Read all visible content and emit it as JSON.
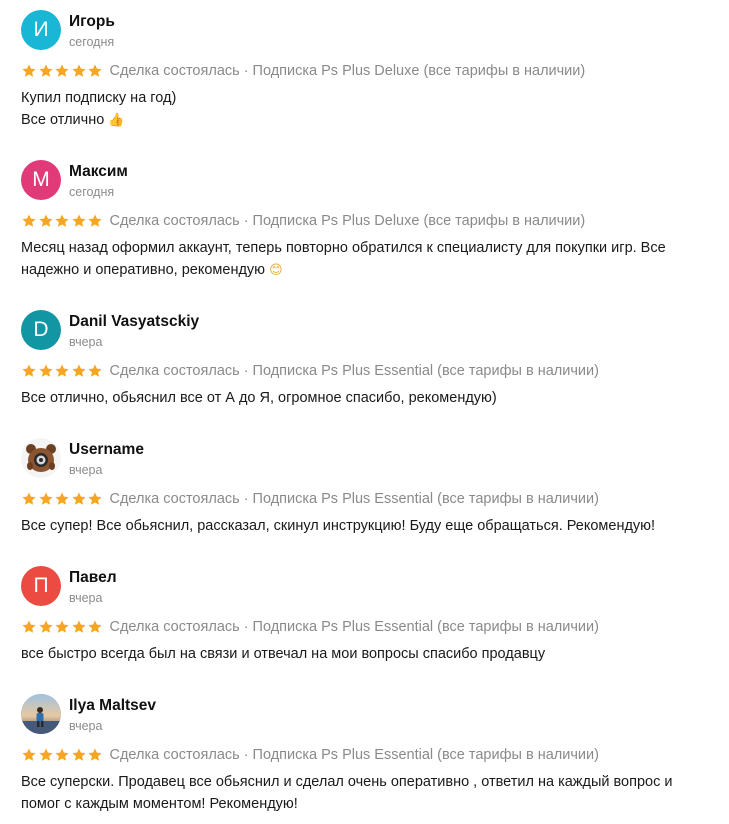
{
  "colors": {
    "star": "#f5a623",
    "avatar_igor": "#19b6d6",
    "avatar_maksim": "#e03a78",
    "avatar_danil": "#1296a4",
    "avatar_pavel": "#ec4b41"
  },
  "reviews": [
    {
      "avatar_letter": "И",
      "avatar_icon": "letter-avatar",
      "name": "Игорь",
      "date": "сегодня",
      "rating": 5,
      "deal": "Сделка состоялась",
      "separator": "·",
      "product": "Подписка Ps Plus Deluxe (все тарифы в наличии)",
      "lines": [
        "Купил подписку на год)",
        "Все отлично"
      ],
      "emoji": "👍"
    },
    {
      "avatar_letter": "М",
      "avatar_icon": "letter-avatar",
      "name": "Максим",
      "date": "сегодня",
      "rating": 5,
      "deal": "Сделка состоялась",
      "separator": "·",
      "product": "Подписка Ps Plus Deluxe (все тарифы в наличии)",
      "lines": [
        "Месяц назад оформил аккаунт, теперь повторно обратился к специалисту для покупки игр. Все",
        "надежно и оперативно, рекомендую"
      ],
      "emoji": "😊"
    },
    {
      "avatar_letter": "D",
      "avatar_icon": "letter-avatar",
      "name": "Danil Vasyatsckiy",
      "date": "вчера",
      "rating": 5,
      "deal": "Сделка состоялась",
      "separator": "·",
      "product": "Подписка Ps Plus Essential (все тарифы в наличии)",
      "lines": [
        "Все отлично, обьяснил все от А до Я, огромное спасибо, рекомендую)"
      ]
    },
    {
      "avatar_icon": "bear-photo-avatar",
      "name": "Username",
      "date": "вчера",
      "rating": 5,
      "deal": "Сделка состоялась",
      "separator": "·",
      "product": "Подписка Ps Plus Essential (все тарифы в наличии)",
      "lines": [
        "Все супер! Все обьяснил, рассказал, скинул инструкцию! Буду еще обращаться. Рекомендую!"
      ]
    },
    {
      "avatar_letter": "П",
      "avatar_icon": "letter-avatar",
      "name": "Павел",
      "date": "вчера",
      "rating": 5,
      "deal": "Сделка состоялась",
      "separator": "·",
      "product": "Подписка Ps Plus Essential (все тарифы в наличии)",
      "lines": [
        "все быстро всегда был на связи и отвечал на мои вопросы спасибо продавцу"
      ]
    },
    {
      "avatar_icon": "sunset-photo-avatar",
      "name": "Ilya Maltsev",
      "date": "вчера",
      "rating": 5,
      "deal": "Сделка состоялась",
      "separator": "·",
      "product": "Подписка Ps Plus Essential (все тарифы в наличии)",
      "lines": [
        "Все суперски. Продавец все обьяснил и сделал очень оперативно , ответил на каждый вопрос и",
        "помог с каждым моментом! Рекомендую!"
      ]
    }
  ]
}
